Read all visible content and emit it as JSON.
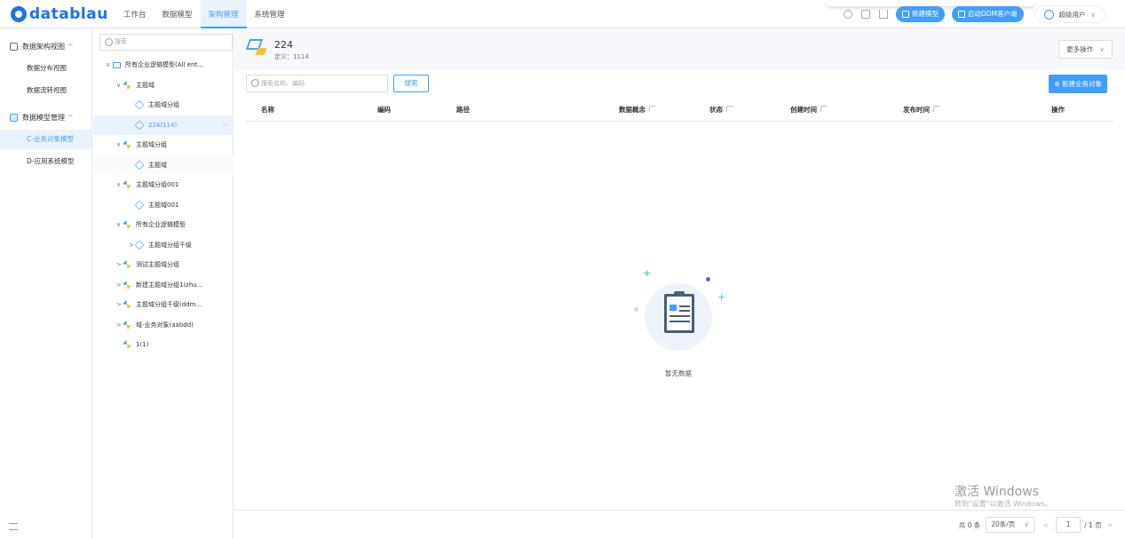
{
  "app": {
    "logo_text": "datablau"
  },
  "nav": {
    "items": [
      "工作台",
      "数据模型",
      "架构管理",
      "系统管理"
    ],
    "active": "架构管理"
  },
  "top_right": {
    "new_model": "新建模型",
    "launch_ddm": "启动DDM客户端",
    "user": "超级用户"
  },
  "sidebar": {
    "group1": "数据架构视图",
    "group1_items": [
      "数据分布视图",
      "数据流转视图"
    ],
    "group2": "数据模型管理",
    "group2_items": [
      "C-业务对象模型",
      "D-应用系统模型"
    ]
  },
  "tree": {
    "search_placeholder": "搜索",
    "nodes": [
      {
        "label": "所有企业逻辑模型(All ent...",
        "level": 0,
        "caret": "∨",
        "icon": "folder-icon"
      },
      {
        "label": "主题域",
        "level": 1,
        "caret": "∨",
        "icon": "domain-icon"
      },
      {
        "label": "主题域分组",
        "level": 2,
        "caret": "",
        "icon": "subject-icon"
      },
      {
        "label": "224(114)",
        "level": 2,
        "caret": "",
        "icon": "subject-icon",
        "selected": true
      },
      {
        "label": "主题域分组",
        "level": 1,
        "caret": "∨",
        "icon": "domain-icon"
      },
      {
        "label": "主题域",
        "level": 2,
        "caret": "",
        "icon": "subject-icon",
        "hover": true
      },
      {
        "label": "主题域分组001",
        "level": 1,
        "caret": "∨",
        "icon": "domain-icon"
      },
      {
        "label": "主题域001",
        "level": 2,
        "caret": "",
        "icon": "subject-icon"
      },
      {
        "label": "所有企业逻辑模型",
        "level": 1,
        "caret": "∨",
        "icon": "domain-icon"
      },
      {
        "label": "主题域分组千级",
        "level": 2,
        "caret": ">",
        "icon": "subject-icon"
      },
      {
        "label": "测试主题域分组",
        "level": 1,
        "caret": ">",
        "icon": "domain-icon"
      },
      {
        "label": "新建主题域分组1(zhu...",
        "level": 1,
        "caret": ">",
        "icon": "domain-icon"
      },
      {
        "label": "主题域分组千级(ddm...",
        "level": 1,
        "caret": ">",
        "icon": "domain-icon"
      },
      {
        "label": "域-业务对象(aabdd)",
        "level": 1,
        "caret": ">",
        "icon": "domain-icon"
      },
      {
        "label": "1(1)",
        "level": 1,
        "caret": "",
        "icon": "domain-icon"
      }
    ],
    "more": "···"
  },
  "main": {
    "title": "224",
    "subtitle": "定义：1114",
    "more_ops": "更多操作",
    "search_placeholder": "搜索名称、编码",
    "search_btn": "搜索",
    "add_btn": "新建业务对象",
    "columns": [
      "名称",
      "编码",
      "路径",
      "数据概念",
      "状态",
      "创建时间",
      "发布时间",
      "操作"
    ],
    "empty_text": "暂无数据"
  },
  "pager": {
    "total": "共 0 条",
    "page_size": "20条/页",
    "page": "1",
    "pages": "/ 1 页"
  },
  "watermark": {
    "line1": "激活 Windows",
    "line2": "转到\"设置\"以激活 Windows。"
  },
  "colors": {
    "accent": "#409eff",
    "nav_active_bg": "#eaf3fd"
  }
}
